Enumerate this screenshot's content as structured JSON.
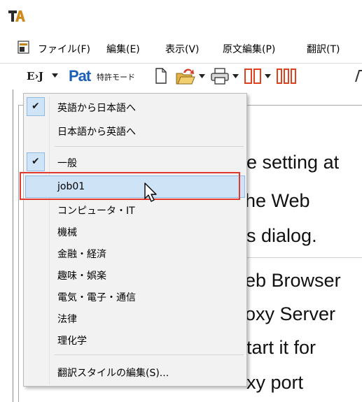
{
  "app": {
    "logo_text": "TA"
  },
  "menubar": {
    "items": [
      {
        "id": "file",
        "label": "ファイル(F)"
      },
      {
        "id": "edit",
        "label": "編集(E)"
      },
      {
        "id": "view",
        "label": "表示(V)"
      },
      {
        "id": "source_edit",
        "label": "原文編集(P)"
      },
      {
        "id": "translate",
        "label": "翻訳(T)"
      }
    ]
  },
  "toolbar": {
    "direction_label": "E›J",
    "patent_mode_label": "特許モード",
    "patent_logo_text": "Pat"
  },
  "document": {
    "lines": [
      {
        "text": "e setting at"
      },
      {
        "text": "he Web"
      },
      {
        "text": "s dialog."
      },
      {
        "text": "eb Browser"
      },
      {
        "text": "oxy Server"
      },
      {
        "text": "tart it for"
      },
      {
        "text": "xy port"
      }
    ]
  },
  "dropdown": {
    "items": [
      {
        "label": "英語から日本語へ",
        "checked": true
      },
      {
        "label": "日本語から英語へ",
        "checked": false
      },
      {
        "label": "一般",
        "checked": true
      },
      {
        "label": "job01",
        "checked": false,
        "hovered": true
      },
      {
        "label": "コンピュータ・IT",
        "checked": false
      },
      {
        "label": "機械",
        "checked": false
      },
      {
        "label": "金融・経済",
        "checked": false
      },
      {
        "label": "趣味・娯楽",
        "checked": false
      },
      {
        "label": "電気・電子・通信",
        "checked": false
      },
      {
        "label": "法律",
        "checked": false
      },
      {
        "label": "理化学",
        "checked": false
      },
      {
        "label": "翻訳スタイルの編集(S)...",
        "checked": false
      }
    ],
    "check_glyph": "✔"
  },
  "colors": {
    "highlight_red": "#e03a2f",
    "hover_blue": "#cfe3f7",
    "check_bg": "#cfe4f7"
  }
}
